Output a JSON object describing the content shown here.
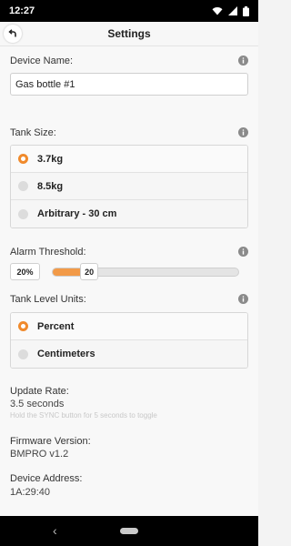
{
  "status_bar": {
    "time": "12:27"
  },
  "header": {
    "title": "Settings"
  },
  "device_name": {
    "label": "Device Name:",
    "value": "Gas bottle #1"
  },
  "tank_size": {
    "label": "Tank Size:",
    "options": [
      "3.7kg",
      "8.5kg",
      "Arbitrary - 30 cm"
    ],
    "selected": "3.7kg"
  },
  "alarm_threshold": {
    "label": "Alarm Threshold:",
    "display": "20%",
    "slider_value": "20",
    "value_fraction": 0.2
  },
  "tank_level_units": {
    "label": "Tank Level Units:",
    "options": [
      "Percent",
      "Centimeters"
    ],
    "selected": "Percent"
  },
  "update_rate": {
    "label": "Update Rate:",
    "value": "3.5 seconds",
    "hint": "Hold the SYNC button for 5 seconds to toggle"
  },
  "firmware": {
    "label": "Firmware Version:",
    "value": "BMPRO v1.2"
  },
  "device_address": {
    "label": "Device Address:",
    "value": "1A:29:40"
  },
  "colors": {
    "accent": "#f08a2c",
    "status_bar": "#000000"
  },
  "icons": [
    "wifi-icon",
    "signal-icon",
    "battery-icon",
    "back-arrow-icon",
    "info-icon",
    "nav-back-icon",
    "nav-home-icon"
  ]
}
